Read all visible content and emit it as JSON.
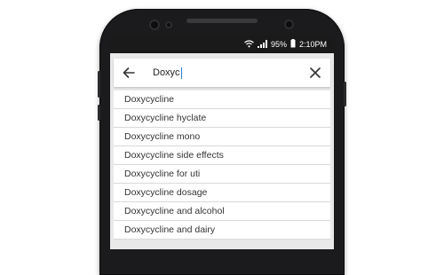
{
  "status": {
    "battery": "95%",
    "time": "2:10PM"
  },
  "search": {
    "query": "Doxyc"
  },
  "suggestions": [
    "Doxycycline",
    "Doxycycline hyclate",
    "Doxycycline mono",
    "Doxycycline side effects",
    "Doxycycline for uti",
    "Doxycycline dosage",
    "Doxycycline and alcohol",
    "Doxycycline and dairy"
  ]
}
